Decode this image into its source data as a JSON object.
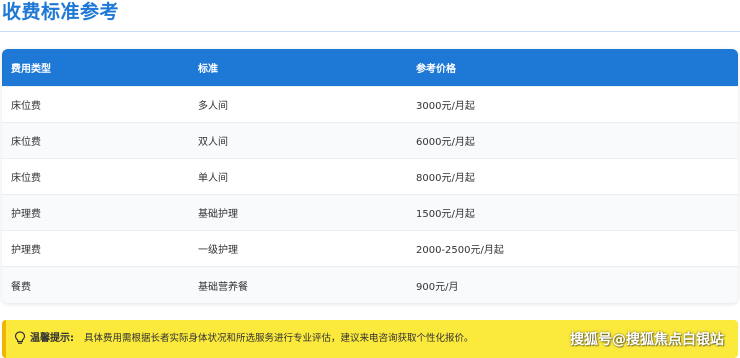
{
  "section": {
    "title": "收费标准参考"
  },
  "table": {
    "headers": [
      "费用类型",
      "标准",
      "参考价格"
    ],
    "rows": [
      [
        "床位费",
        "多人间",
        "3000元/月起"
      ],
      [
        "床位费",
        "双人间",
        "6000元/月起"
      ],
      [
        "床位费",
        "单人间",
        "8000元/月起"
      ],
      [
        "护理费",
        "基础护理",
        "1500元/月起"
      ],
      [
        "护理费",
        "一级护理",
        "2000-2500元/月起"
      ],
      [
        "餐费",
        "基础营养餐",
        "900元/月"
      ]
    ]
  },
  "tip": {
    "icon": "lightbulb-icon",
    "label": "温馨提示:",
    "text": "具体费用需根据长者实际身体状况和所选服务进行专业评估，建议来电咨询获取个性化报价。"
  },
  "watermark": {
    "text": "搜狐号@搜狐焦点白银站"
  },
  "colors": {
    "accent": "#1e78d6",
    "tip_background": "#fbe93c",
    "tip_border": "#f3b400"
  }
}
